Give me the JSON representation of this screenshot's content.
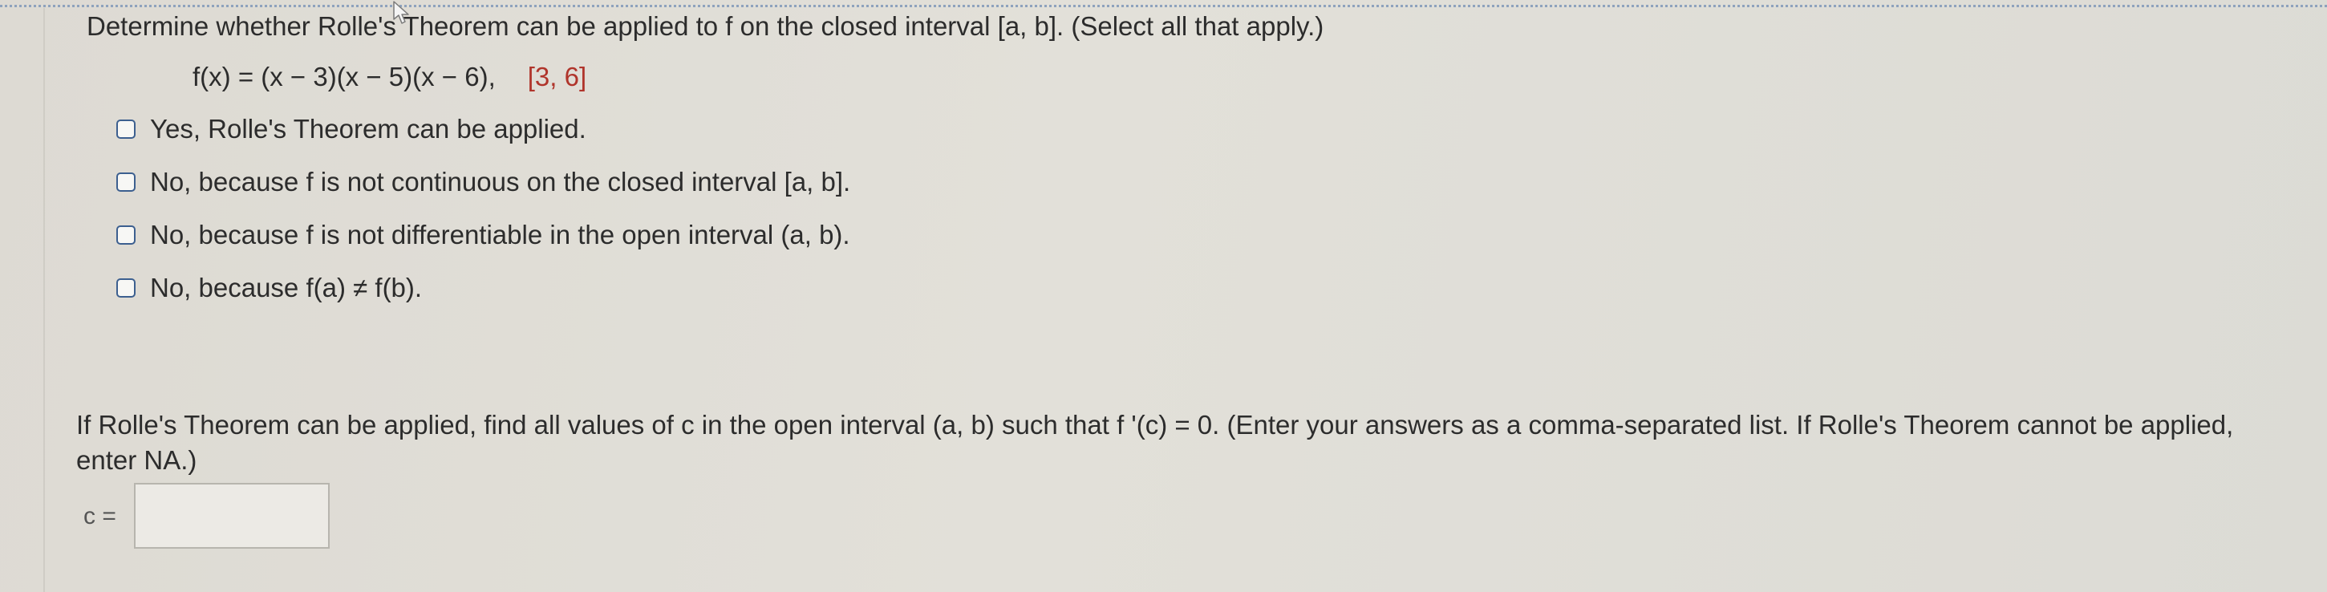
{
  "question1": {
    "instruction": "Determine whether Rolle's Theorem can be applied to f on the closed interval  [a, b]. (Select all that apply.)",
    "function": "f(x) = (x − 3)(x − 5)(x − 6),",
    "interval": "[3, 6]",
    "options": [
      {
        "label": "Yes, Rolle's Theorem can be applied.",
        "checked": false
      },
      {
        "label": "No, because f is not continuous on the closed interval [a, b].",
        "checked": false
      },
      {
        "label": "No, because f is not differentiable in the open interval (a, b).",
        "checked": false
      },
      {
        "label": "No, because f(a) ≠ f(b).",
        "checked": false
      }
    ]
  },
  "question2": {
    "prompt": "If Rolle's Theorem can be applied, find all values of c in the open interval  (a, b)  such that  f '(c) = 0.  (Enter your answers as a comma-separated list. If Rolle's Theorem cannot be applied, enter NA.)",
    "answer_label": "c =",
    "answer_value": ""
  },
  "colors": {
    "interval": "#b0342b",
    "checkbox_border": "#3c5f8f",
    "top_border": "#8ea2bd"
  },
  "icons": {
    "cursor": "mouse-pointer-icon"
  }
}
